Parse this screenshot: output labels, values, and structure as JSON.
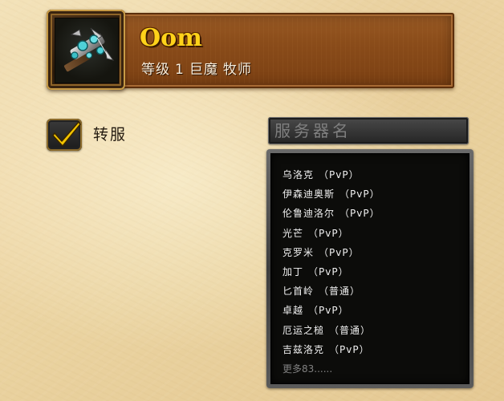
{
  "character": {
    "name": "Oom",
    "level_prefix": "等级",
    "level": "1",
    "race": "巨魔",
    "class": "牧师",
    "portrait_icon": "crossbow-icon"
  },
  "transfer": {
    "label": "转服",
    "checked": true,
    "check_color": "#f2c400"
  },
  "search": {
    "placeholder": "服务器名",
    "value": ""
  },
  "servers": {
    "items": [
      {
        "name": "乌洛克",
        "type": "（PvP）"
      },
      {
        "name": "伊森迪奥斯",
        "type": "（PvP）"
      },
      {
        "name": "伦鲁迪洛尔",
        "type": "（PvP）"
      },
      {
        "name": "光芒",
        "type": "（PvP）"
      },
      {
        "name": "克罗米",
        "type": "（PvP）"
      },
      {
        "name": "加丁",
        "type": "（PvP）"
      },
      {
        "name": "匕首岭",
        "type": "（普通）"
      },
      {
        "name": "卓越",
        "type": "（PvP）"
      },
      {
        "name": "厄运之槌",
        "type": "（普通）"
      },
      {
        "name": "吉兹洛克",
        "type": "（PvP）"
      }
    ],
    "more_label": "更多83......"
  },
  "colors": {
    "name_gold": "#ffd21a",
    "banner_brown": "#8a4c1a",
    "list_bg": "#0c0c0a",
    "muted_gray": "#808080"
  }
}
